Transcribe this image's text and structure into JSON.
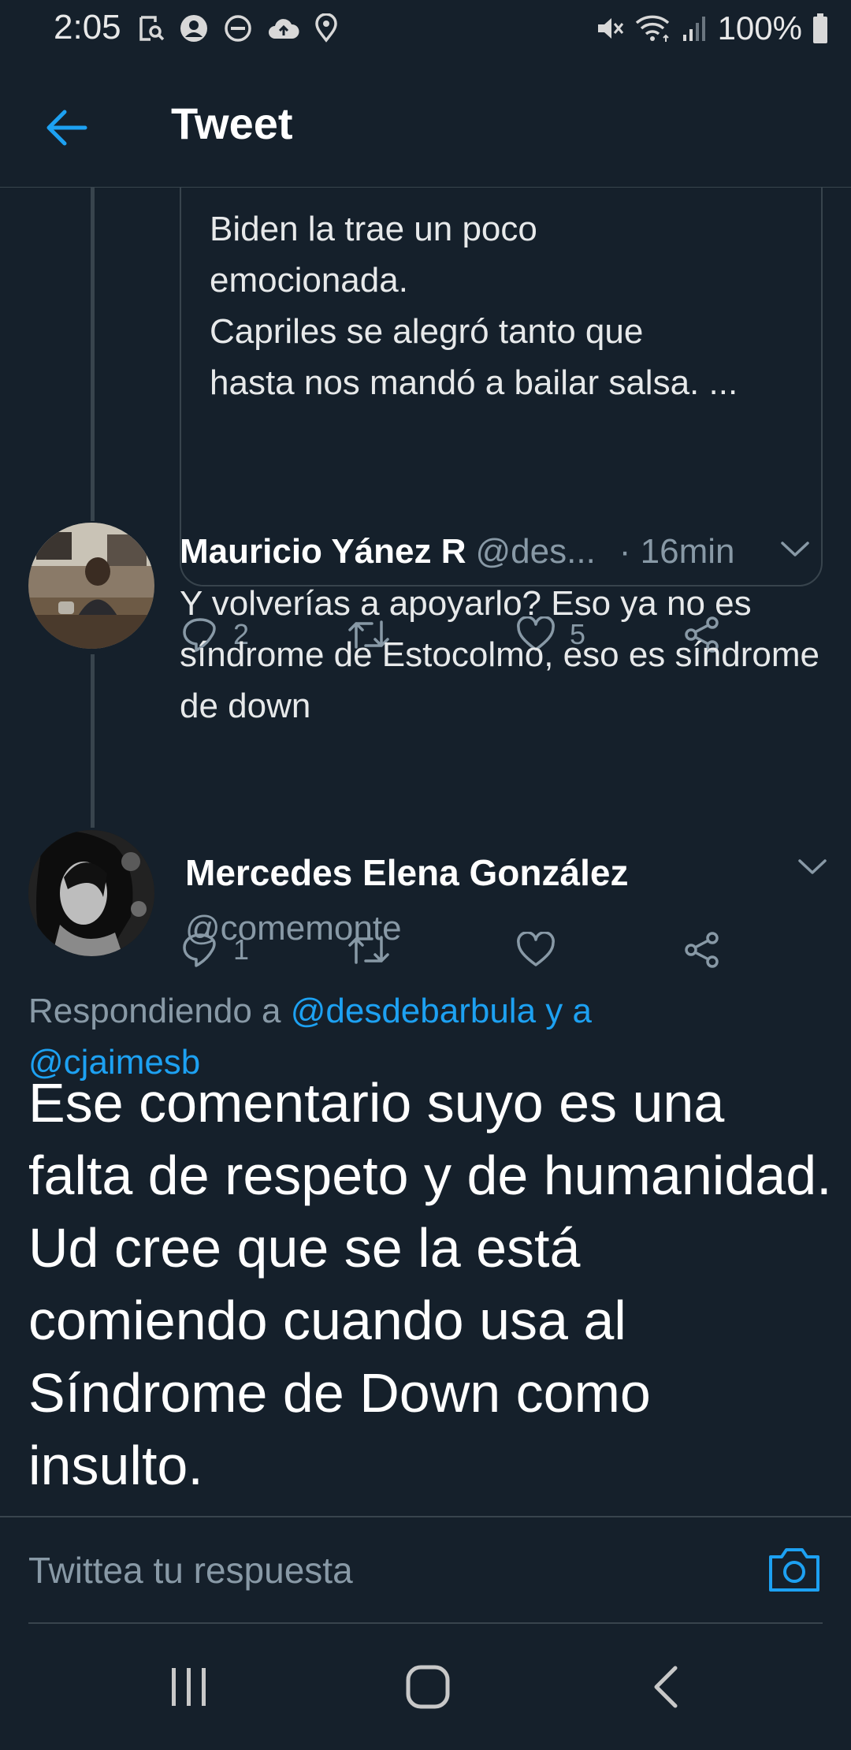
{
  "status_bar": {
    "time": "2:05",
    "battery": "100%"
  },
  "header": {
    "title": "Tweet"
  },
  "quoted_tweet": {
    "lines": [
      "Biden la trae un poco",
      "emocionada.",
      "Capriles se alegró tanto que",
      "hasta nos mandó a bailar salsa. ..."
    ],
    "actions": {
      "reply_count": "2",
      "like_count": "5"
    }
  },
  "reply_tweet": {
    "name": "Mauricio Yánez R",
    "handle": "@des...",
    "time": "· 16min",
    "text": "Y volverías a apoyarlo? Eso ya no es síndrome de Estocolmo, eso es síndrome de down",
    "actions": {
      "reply_count": "1",
      "like_count": ""
    }
  },
  "main_tweet": {
    "name": "Mercedes Elena González",
    "handle": "@comemonte",
    "replying_prefix": "Respondiendo a",
    "replying_mention_1": "@desdebarbula y a",
    "replying_mention_2": "@cjaimesb",
    "text": "Ese comentario suyo es una falta de respeto y de humanidad. Ud cree que se la está comiendo cuando usa al Síndrome de Down como insulto."
  },
  "compose": {
    "placeholder": "Twittea tu respuesta"
  },
  "colors": {
    "background": "#15202b",
    "accent": "#1da1f2",
    "secondary_text": "#8899a6",
    "divider": "#38444d"
  },
  "icons": {
    "status_left": [
      "screenshot-icon",
      "account-icon",
      "do-not-disturb-icon",
      "cloud-upload-icon",
      "location-icon"
    ],
    "status_right": [
      "mute-icon",
      "wifi-icon",
      "signal-icon",
      "battery-icon"
    ],
    "nav": [
      "recents-icon",
      "home-icon",
      "back-icon"
    ]
  }
}
